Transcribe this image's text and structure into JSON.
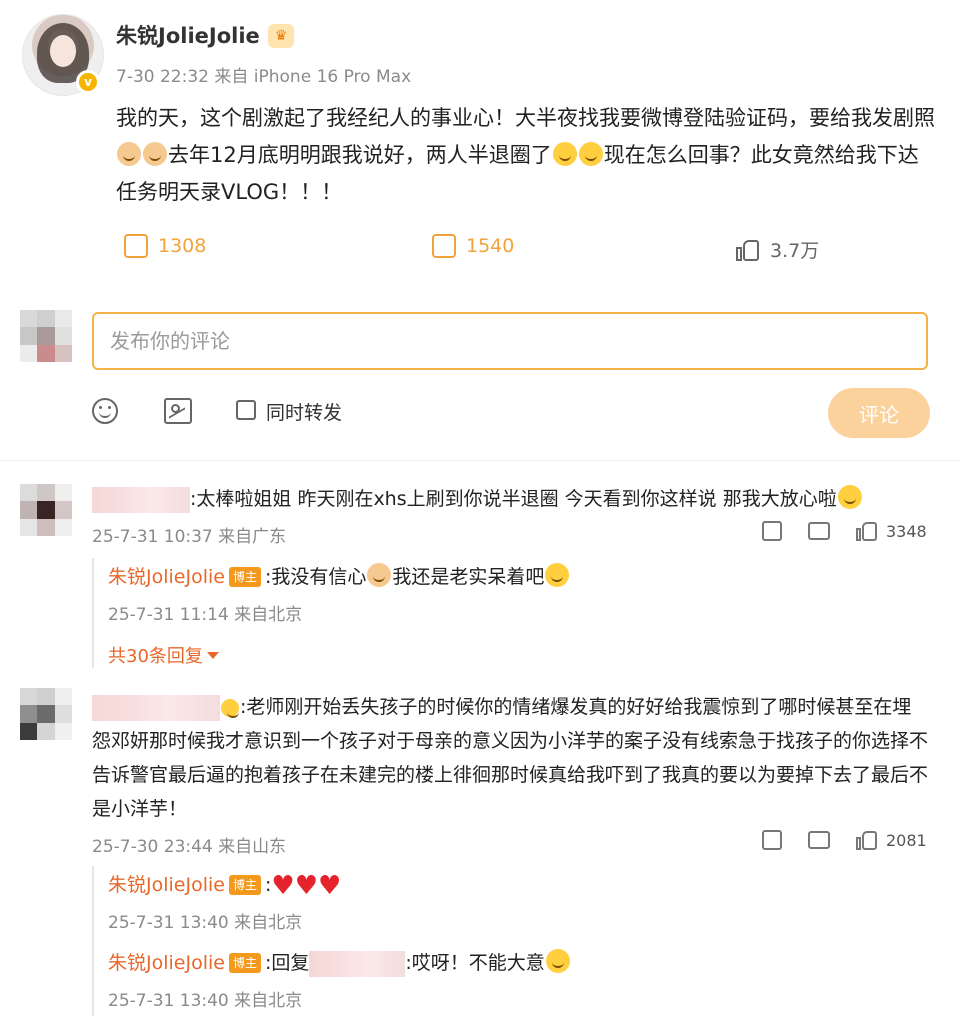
{
  "post": {
    "author": "朱锐JolieJolie",
    "meta": "7-30 22:32 来自 iPhone 16 Pro Max",
    "text_1": "我的天，这个剧激起了我经纪人的事业心！大半夜找我要微博登陆验证码，要给我发剧照",
    "text_2": "去年12月底明明跟我说好，两人半退圈了",
    "text_3": "现在怎么回事？此女竟然给我下达任务明天录VLOG！！！",
    "shares": "1308",
    "comments": "1540",
    "likes": "3.7万"
  },
  "composer": {
    "placeholder": "发布你的评论",
    "repost_label": "同时转发",
    "submit_label": "评论"
  },
  "comments": [
    {
      "text": ":太棒啦姐姐 昨天刚在xhs上刷到你说半退圈 今天看到你这样说 那我大放心啦",
      "meta": "25-7-31 10:37 来自广东",
      "likes": "3348",
      "replies": [
        {
          "author": "朱锐JolieJolie",
          "tag": "博主",
          "text_1": ":我没有信心",
          "text_2": "我还是老实呆着吧",
          "meta": "25-7-31 11:14 来自北京"
        }
      ],
      "more": "共30条回复"
    },
    {
      "text": ":老师刚开始丢失孩子的时候你的情绪爆发真的好好给我震惊到了哪时候甚至在埋怨邓妍那时候我才意识到一个孩子对于母亲的意义因为小洋芋的案子没有线索急于找孩子的你选择不告诉警官最后逼的抱着孩子在未建完的楼上徘徊那时候真给我吓到了我真的要以为要掉下去了最后不是小洋芋！",
      "meta": "25-7-30 23:44 来自山东",
      "likes": "2081",
      "replies": [
        {
          "author": "朱锐JolieJolie",
          "tag": "博主",
          "text_1": ":",
          "meta": "25-7-31 13:40 来自北京"
        },
        {
          "author": "朱锐JolieJolie",
          "tag": "博主",
          "text_1": ":回复",
          "text_2": ":哎呀！不能大意",
          "meta": "25-7-31 13:40 来自北京"
        }
      ]
    }
  ],
  "colors": {
    "accent": "#f2a23a",
    "author_orange": "#e8682a",
    "heart": "#e5232c"
  }
}
